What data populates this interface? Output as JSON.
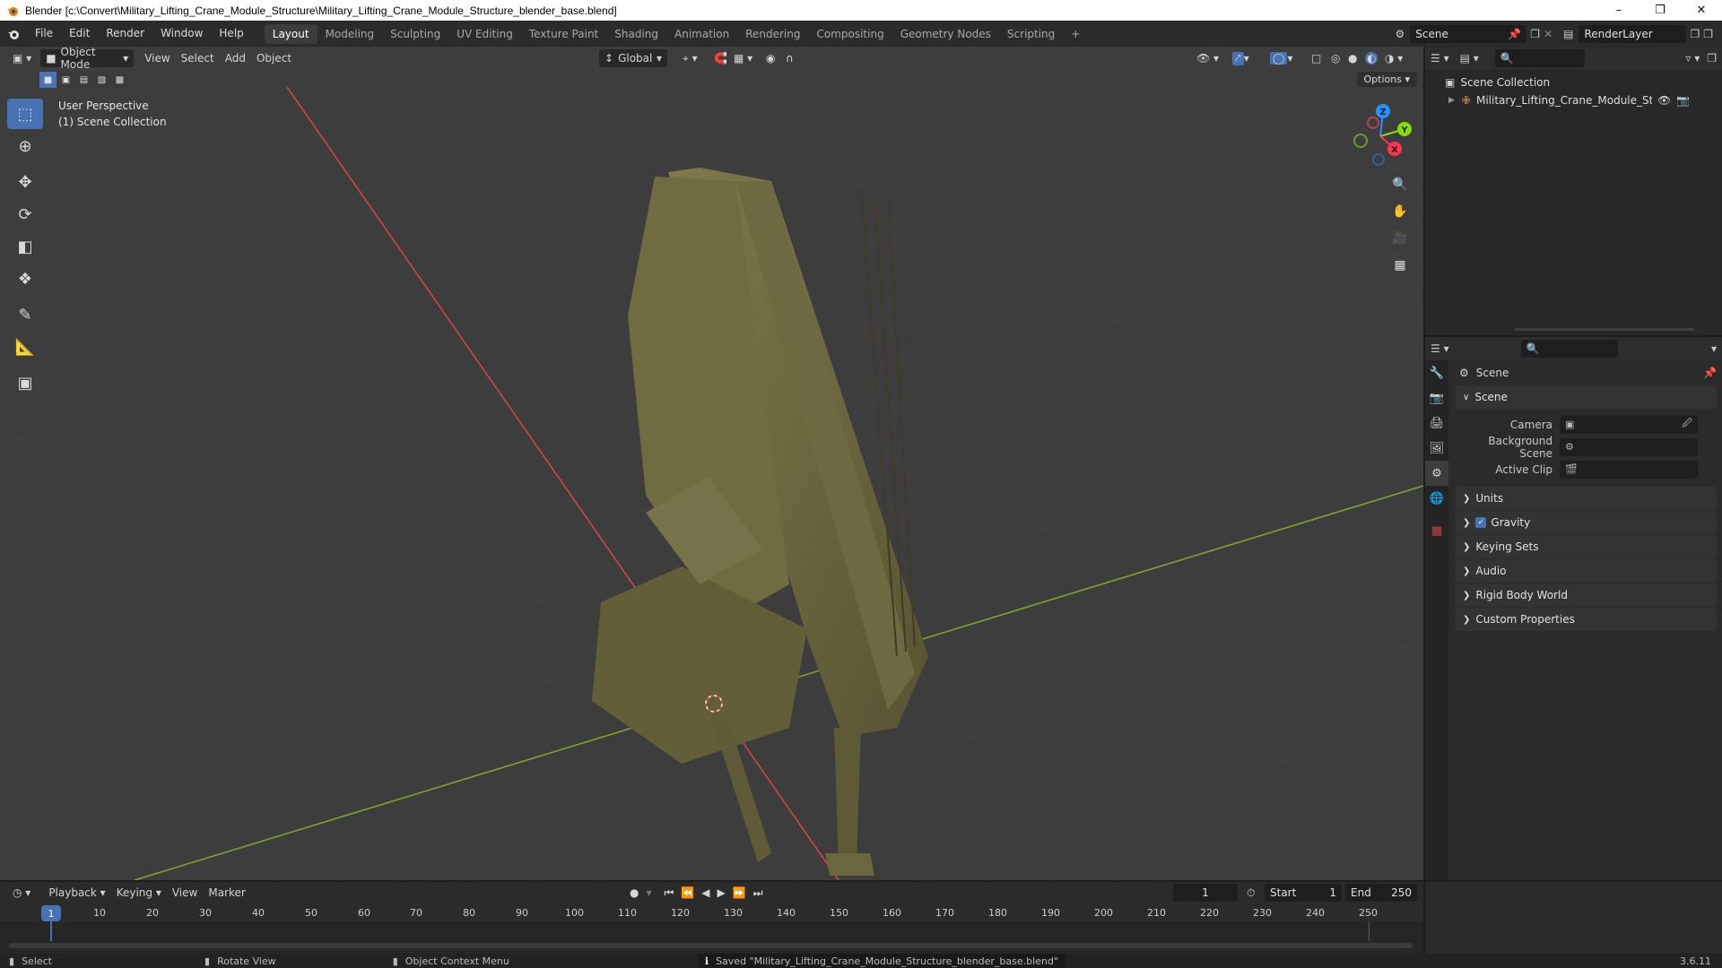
{
  "window": {
    "title": "Blender [c:\\Convert\\Military_Lifting_Crane_Module_Structure\\Military_Lifting_Crane_Module_Structure_blender_base.blend]",
    "app_icon": "blender-icon",
    "controls": [
      "minimize-icon",
      "maximize-icon",
      "close-icon"
    ]
  },
  "menu": {
    "items": [
      "File",
      "Edit",
      "Render",
      "Window",
      "Help"
    ],
    "workspaces": [
      "Layout",
      "Modeling",
      "Sculpting",
      "UV Editing",
      "Texture Paint",
      "Shading",
      "Animation",
      "Rendering",
      "Compositing",
      "Geometry Nodes",
      "Scripting"
    ],
    "active_workspace": "Layout",
    "add_workspace": "+",
    "scene_name": "Scene",
    "render_layer": "RenderLayer"
  },
  "viewport": {
    "mode": "Object Mode",
    "header_menus": [
      "View",
      "Select",
      "Add",
      "Object"
    ],
    "transform_orientation": "Global",
    "options_label": "Options",
    "perspective": "User Perspective",
    "collection": "(1) Scene Collection",
    "gizmo_axes": [
      "Z",
      "Y",
      "X"
    ],
    "tools": [
      "select-box-icon",
      "cursor-icon",
      "move-icon",
      "rotate-icon",
      "scale-icon",
      "transform-icon",
      "annotate-icon",
      "measure-icon",
      "add-cube-icon"
    ]
  },
  "outliner": {
    "root": "Scene Collection",
    "items": [
      {
        "name": "Military_Lifting_Crane_Module_Structure"
      }
    ]
  },
  "properties": {
    "context": "Scene",
    "sections": {
      "scene_panel": "Scene",
      "camera_label": "Camera",
      "background_scene_label": "Background Scene",
      "active_clip_label": "Active Clip",
      "collapsed": [
        "Units",
        "Gravity",
        "Keying Sets",
        "Audio",
        "Rigid Body World",
        "Custom Properties"
      ]
    },
    "gravity_enabled": true
  },
  "timeline": {
    "menus": [
      "Playback",
      "Keying",
      "View",
      "Marker"
    ],
    "current_frame": "1",
    "start_label": "Start",
    "start": "1",
    "end_label": "End",
    "end": "250",
    "ticks": [
      "1",
      "10",
      "20",
      "30",
      "40",
      "50",
      "60",
      "70",
      "80",
      "90",
      "100",
      "110",
      "120",
      "130",
      "140",
      "150",
      "160",
      "170",
      "180",
      "190",
      "200",
      "210",
      "220",
      "230",
      "240",
      "250"
    ]
  },
  "status": {
    "select": "Select",
    "rotate": "Rotate View",
    "context_menu": "Object Context Menu",
    "message": "Saved \"Military_Lifting_Crane_Module_Structure_blender_base.blend\"",
    "version": "3.6.11"
  },
  "colors": {
    "accent": "#4772b3",
    "axis_x": "#ff3352",
    "axis_y": "#8bdc00",
    "axis_z": "#2890ff",
    "model": "#6e6a3e"
  }
}
